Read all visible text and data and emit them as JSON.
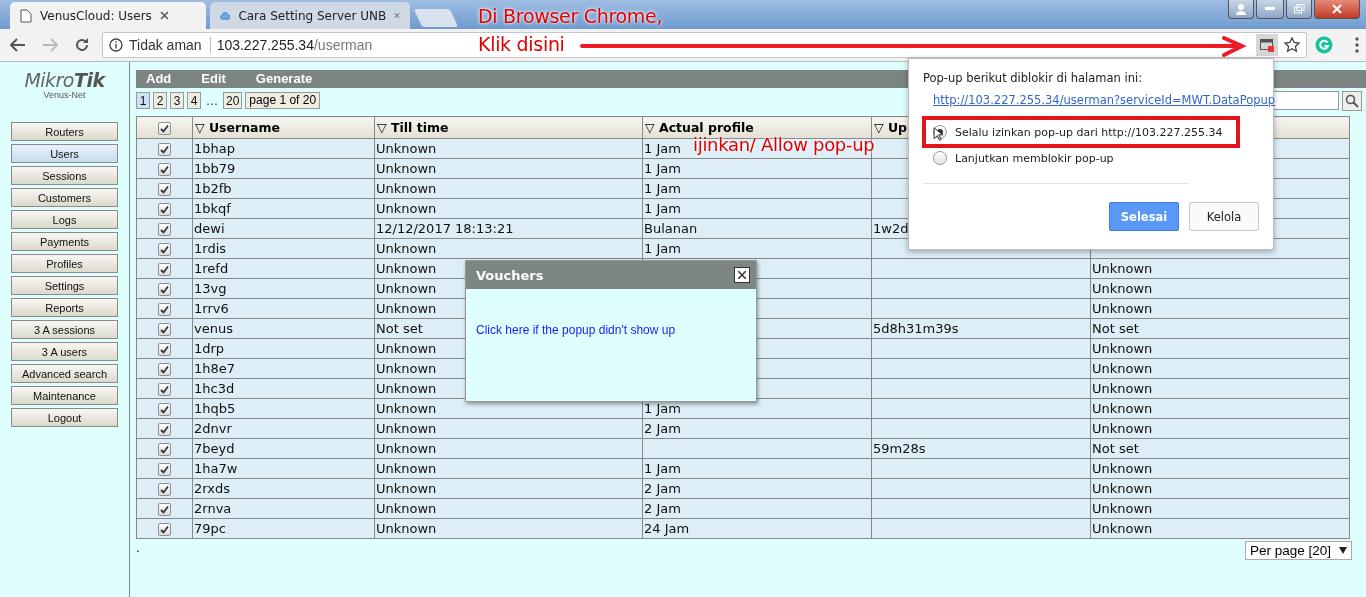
{
  "browser": {
    "tabs": [
      {
        "title": "VenusCloud: Users",
        "selected": true,
        "kind": "page"
      },
      {
        "title": "Cara Setting Server UNB",
        "selected": false,
        "kind": "cloud"
      }
    ],
    "address": {
      "security": "Tidak aman",
      "host": "103.227.255.34",
      "path": "/userman"
    }
  },
  "annotations": {
    "top_note": [
      "Di Browser Chrome,",
      "Klik disini"
    ],
    "allow_note": "ijinkan/ Allow pop-up"
  },
  "sidebar": {
    "logo": "Mikro**Tik**",
    "subtitle": "Venus-Net",
    "items": [
      {
        "label": "Routers",
        "selected": false
      },
      {
        "label": "Users",
        "selected": true
      },
      {
        "label": "Sessions",
        "selected": false
      },
      {
        "label": "Customers",
        "selected": false
      },
      {
        "label": "Logs",
        "selected": false
      },
      {
        "label": "Payments",
        "selected": false
      },
      {
        "label": "Profiles",
        "selected": false
      },
      {
        "label": "Settings",
        "selected": false
      },
      {
        "label": "Reports",
        "selected": false
      },
      {
        "label": "3 A sessions",
        "selected": false
      },
      {
        "label": "3 A users",
        "selected": false
      },
      {
        "label": "Advanced search",
        "selected": false
      },
      {
        "label": "Maintenance",
        "selected": false
      },
      {
        "label": "Logout",
        "selected": false
      }
    ]
  },
  "toolbar": [
    "Add",
    "Edit",
    "Generate"
  ],
  "pagination": {
    "pages": [
      {
        "label": "1",
        "selected": true
      },
      {
        "label": "2",
        "selected": false
      },
      {
        "label": "3",
        "selected": false
      },
      {
        "label": "4",
        "selected": false
      },
      {
        "label": "…",
        "kind": "gap"
      },
      {
        "label": "20",
        "selected": false
      }
    ],
    "info": "page 1 of 20"
  },
  "table": {
    "all_checked": true,
    "columns": [
      "▽ Username",
      "▽ Till time",
      "▽ Actual profile",
      "▽ Up"
    ],
    "rows": [
      {
        "checked": true,
        "username": "1bhap",
        "till_time": "Unknown",
        "actual_profile": "1 Jam"
      },
      {
        "checked": true,
        "username": "1bb79",
        "till_time": "Unknown",
        "actual_profile": "1 Jam"
      },
      {
        "checked": true,
        "username": "1b2fb",
        "till_time": "Unknown",
        "actual_profile": "1 Jam"
      },
      {
        "checked": true,
        "username": "1bkqf",
        "till_time": "Unknown",
        "actual_profile": "1 Jam"
      },
      {
        "checked": true,
        "username": "dewi",
        "till_time": "12/12/2017 18:13:21",
        "actual_profile": "Bulanan",
        "column_4": "1w2d"
      },
      {
        "checked": true,
        "username": "1rdis",
        "till_time": "Unknown",
        "actual_profile": "1 Jam"
      },
      {
        "checked": true,
        "username": "1refd",
        "till_time": "Unknown",
        "column_5": "Unknown"
      },
      {
        "checked": true,
        "username": "13vg",
        "till_time": "Unknown",
        "column_5": "Unknown"
      },
      {
        "checked": true,
        "username": "1rrv6",
        "till_time": "Unknown",
        "column_5": "Unknown"
      },
      {
        "checked": true,
        "username": "venus",
        "till_time": "Not set",
        "column_4": "5d8h31m39s",
        "column_5": "Not set"
      },
      {
        "checked": true,
        "username": "1drp",
        "till_time": "Unknown",
        "column_5": "Unknown"
      },
      {
        "checked": true,
        "username": "1h8e7",
        "till_time": "Unknown",
        "column_5": "Unknown"
      },
      {
        "checked": true,
        "username": "1hc3d",
        "till_time": "Unknown",
        "column_5": "Unknown"
      },
      {
        "checked": true,
        "username": "1hqb5",
        "till_time": "Unknown",
        "actual_profile": "1 Jam",
        "column_5": "Unknown"
      },
      {
        "checked": true,
        "username": "2dnvr",
        "till_time": "Unknown",
        "actual_profile": "2 Jam",
        "column_5": "Unknown"
      },
      {
        "checked": true,
        "username": "7beyd",
        "till_time": "Unknown",
        "column_4": "59m28s",
        "column_5": "Not set"
      },
      {
        "checked": true,
        "username": "1ha7w",
        "till_time": "Unknown",
        "actual_profile": "1 Jam",
        "column_5": "Unknown"
      },
      {
        "checked": true,
        "username": "2rxds",
        "till_time": "Unknown",
        "actual_profile": "2 Jam",
        "column_5": "Unknown"
      },
      {
        "checked": true,
        "username": "2rnva",
        "till_time": "Unknown",
        "actual_profile": "2 Jam",
        "column_5": "Unknown"
      },
      {
        "checked": true,
        "username": "79pc",
        "till_time": "Unknown",
        "actual_profile": "24 Jam",
        "column_5": "Unknown"
      }
    ]
  },
  "footer_mark": ".",
  "per_page": "Per page [20]",
  "vouchers_dialog": {
    "title": "Vouchers",
    "link": "Click here if the popup didn't show up"
  },
  "popup_blocked": {
    "message": "Pop-up berikut diblokir di halaman ini:",
    "link": "http://103.227.255.34/userman?serviceId=MWT.DataPopup",
    "options": [
      {
        "label": "Selalu izinkan pop-up dari http://103.227.255.34",
        "selected": true
      },
      {
        "label": "Lanjutkan memblokir pop-up",
        "selected": false
      }
    ],
    "buttons": [
      {
        "label": "Selesai",
        "kind": "primary"
      },
      {
        "label": "Kelola",
        "kind": "default"
      }
    ]
  }
}
